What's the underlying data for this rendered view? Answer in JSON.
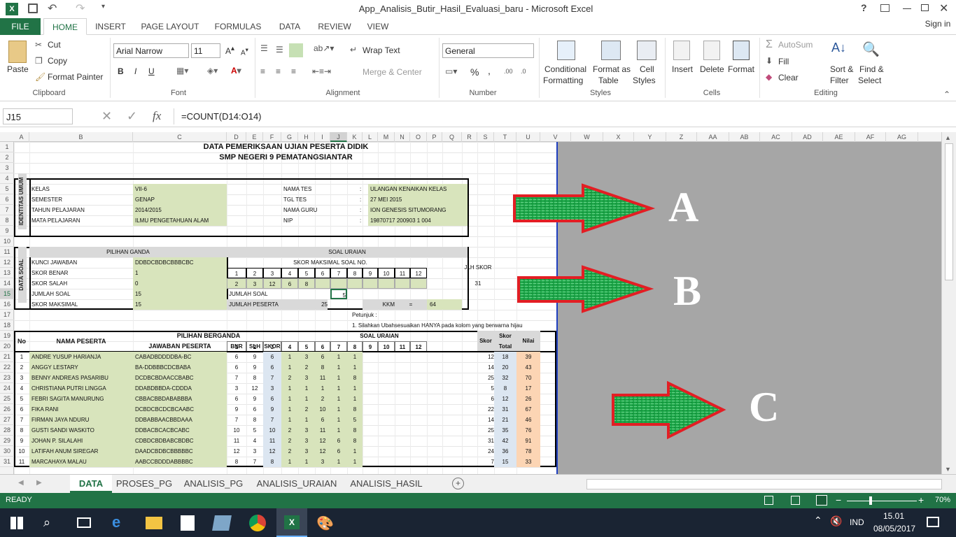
{
  "app": {
    "title": "App_Analisis_Butir_Hasil_Evaluasi_baru - Microsoft Excel",
    "help": "?",
    "signin": "Sign in"
  },
  "ribbon_tabs": [
    "FILE",
    "HOME",
    "INSERT",
    "PAGE LAYOUT",
    "FORMULAS",
    "DATA",
    "REVIEW",
    "VIEW"
  ],
  "clipboard": {
    "paste": "Paste",
    "cut": "Cut",
    "copy": "Copy",
    "format_painter": "Format Painter",
    "label": "Clipboard"
  },
  "font": {
    "name": "Arial Narrow",
    "size": "11",
    "bold": "B",
    "italic": "I",
    "underline": "U",
    "label": "Font"
  },
  "alignment": {
    "wrap": "Wrap Text",
    "merge": "Merge & Center",
    "label": "Alignment"
  },
  "number": {
    "format": "General",
    "percent": "%",
    "comma": ",",
    "label": "Number"
  },
  "styles": {
    "cond": "Conditional",
    "cond2": "Formatting",
    "fmt_table": "Format as",
    "fmt_table2": "Table",
    "cell_styles": "Cell",
    "cell_styles2": "Styles",
    "label": "Styles"
  },
  "cells": {
    "insert": "Insert",
    "delete": "Delete",
    "format": "Format",
    "label": "Cells"
  },
  "editing": {
    "autosum": "AutoSum",
    "fill": "Fill",
    "clear": "Clear",
    "sort": "Sort &",
    "sort2": "Filter",
    "find": "Find &",
    "find2": "Select",
    "label": "Editing"
  },
  "formula_bar": {
    "name_box": "J15",
    "fx": "fx",
    "formula": "=COUNT(D14:O14)"
  },
  "columns": [
    "A",
    "B",
    "C",
    "D",
    "E",
    "F",
    "G",
    "H",
    "I",
    "J",
    "K",
    "L",
    "M",
    "N",
    "O",
    "P",
    "Q",
    "R",
    "S",
    "T",
    "U",
    "V",
    "W",
    "X",
    "Y",
    "Z",
    "AA",
    "AB",
    "AC",
    "AD",
    "AE",
    "AF",
    "AG"
  ],
  "rows": [
    "1",
    "2",
    "3",
    "4",
    "5",
    "6",
    "7",
    "8",
    "9",
    "10",
    "11",
    "12",
    "13",
    "14",
    "15",
    "16",
    "17",
    "18",
    "19",
    "20",
    "21",
    "22",
    "23",
    "24",
    "25",
    "26",
    "27",
    "28",
    "29",
    "30",
    "31"
  ],
  "sheet": {
    "title1": "DATA PEMERIKSAAN UJIAN PESERTA DIDIK",
    "title2": "SMP NEGERI 9 PEMATANGSIANTAR",
    "identitas": "IDENTITAS UMUM",
    "kelas_l": "KELAS",
    "kelas_v": "VII-6",
    "semester_l": "SEMESTER",
    "semester_v": "GENAP",
    "tahun_l": "TAHUN PELAJARAN",
    "tahun_v": "2014/2015",
    "mapel_l": "MATA PELAJARAN",
    "mapel_v": "ILMU PENGETAHUAN ALAM",
    "namates_l": "NAMA TES",
    "namates_v": "ULANGAN KENAIKAN KELAS",
    "tgl_l": "TGL TES",
    "tgl_v": "27 MEI 2015",
    "guru_l": "NAMA GURU",
    "guru_v": "ION GENESIS SITUMORANG",
    "nip_l": "NIP",
    "nip_v": "19870717 200903 1 004",
    "colon": ":",
    "datasoal": "DATA SOAL",
    "pg": "PILIHAN GANDA",
    "uraian": "SOAL URAIAN",
    "kunci_l": "KUNCI JAWABAN",
    "kunci_v": "DDBDCBDBCBBBCBC",
    "benar_l": "SKOR BENAR",
    "benar_v": "1",
    "salah_l": "SKOR SALAH",
    "salah_v": "0",
    "jsoal_l": "JUMLAH SOAL",
    "jsoal_v": "15",
    "maks_l": "SKOR MAKSIMAL",
    "maks_v": "15",
    "skormaks": "SKOR MAKSIMAL SOAL NO.",
    "jlh": "JLH SKOR",
    "soalno": [
      "1",
      "2",
      "3",
      "4",
      "5",
      "6",
      "7",
      "8",
      "9",
      "10",
      "11",
      "12"
    ],
    "skorsoal": [
      "2",
      "3",
      "12",
      "6",
      "8",
      "",
      "",
      "",
      "",
      "",
      "",
      ""
    ],
    "jlh_v": "31",
    "ur_jsoal_l": "JUMLAH SOAL",
    "ur_jsoal_v": "5",
    "ur_jp_l": "JUMLAH PESERTA",
    "ur_jp_v": "25",
    "kkm_l": "KKM",
    "eq": "=",
    "kkm_v": "64",
    "petunjuk": "Petunjuk :",
    "petunjuk1": "1. Silahkan Ubahsesuaikan HANYA pada kolom yang berwarna hijau",
    "h_no": "No",
    "h_nama": "NAMA PESERTA",
    "h_pb": "PILIHAN BERGANDA",
    "h_jp": "JAWABAN PESERTA",
    "h_bnr": "BNR",
    "h_slh": "SLH",
    "h_skor": "SKOR",
    "h_su": "SOAL URAIAN",
    "h_skor2": "Skor",
    "h_skort": "Skor",
    "h_total": "Total",
    "h_nilai": "Nilai",
    "students": [
      {
        "no": "1",
        "nama": "ANDRE YUSUP HARIANJA",
        "jwb": "CABADBDDDDBA-BC",
        "bnr": "6",
        "slh": "9",
        "skor": "6",
        "u": [
          "1",
          "3",
          "6",
          "1",
          "1"
        ],
        "sk": "12",
        "tot": "18",
        "nilai": "39"
      },
      {
        "no": "2",
        "nama": "ANGGY LESTARY",
        "jwb": "BA-DDBBBCDCBABA",
        "bnr": "6",
        "slh": "9",
        "skor": "6",
        "u": [
          "1",
          "2",
          "8",
          "1",
          "1"
        ],
        "sk": "14",
        "tot": "20",
        "nilai": "43"
      },
      {
        "no": "3",
        "nama": "BENNY ANDREAS PASARIBU",
        "jwb": "DCDBCBDAACCBABC",
        "bnr": "7",
        "slh": "8",
        "skor": "7",
        "u": [
          "2",
          "3",
          "11",
          "1",
          "8"
        ],
        "sk": "25",
        "tot": "32",
        "nilai": "70"
      },
      {
        "no": "4",
        "nama": "CHRISTIANA PUTRI LINGGA",
        "jwb": "DDABDBBDA-CDDDA",
        "bnr": "3",
        "slh": "12",
        "skor": "3",
        "u": [
          "1",
          "1",
          "1",
          "1",
          "1"
        ],
        "sk": "5",
        "tot": "8",
        "nilai": "17"
      },
      {
        "no": "5",
        "nama": "FEBRI SAGITA MANURUNG",
        "jwb": "CBBACBBDABABBBA",
        "bnr": "6",
        "slh": "9",
        "skor": "6",
        "u": [
          "1",
          "1",
          "2",
          "1",
          "1"
        ],
        "sk": "6",
        "tot": "12",
        "nilai": "26"
      },
      {
        "no": "6",
        "nama": "FIKA RANI",
        "jwb": "DCBDCBCDCBCAABC",
        "bnr": "9",
        "slh": "6",
        "skor": "9",
        "u": [
          "1",
          "2",
          "10",
          "1",
          "8"
        ],
        "sk": "22",
        "tot": "31",
        "nilai": "67"
      },
      {
        "no": "7",
        "nama": "FIRMAN JAYA NDURU",
        "jwb": "DDBABBAACBBDAAA",
        "bnr": "7",
        "slh": "8",
        "skor": "7",
        "u": [
          "1",
          "1",
          "6",
          "1",
          "5"
        ],
        "sk": "14",
        "tot": "21",
        "nilai": "46"
      },
      {
        "no": "8",
        "nama": "GUSTI SANDI WASKITO",
        "jwb": "DDBACBCACBCABC",
        "bnr": "10",
        "slh": "5",
        "skor": "10",
        "u": [
          "2",
          "3",
          "11",
          "1",
          "8"
        ],
        "sk": "25",
        "tot": "35",
        "nilai": "76"
      },
      {
        "no": "9",
        "nama": "JOHAN P. SILALAHI",
        "jwb": "CDBDCBDBABCBDBC",
        "bnr": "11",
        "slh": "4",
        "skor": "11",
        "u": [
          "2",
          "3",
          "12",
          "6",
          "8"
        ],
        "sk": "31",
        "tot": "42",
        "nilai": "91"
      },
      {
        "no": "10",
        "nama": "LATIFAH ANUM SIREGAR",
        "jwb": "DAADCBDBCBBBBBC",
        "bnr": "12",
        "slh": "3",
        "skor": "12",
        "u": [
          "2",
          "3",
          "12",
          "6",
          "1"
        ],
        "sk": "24",
        "tot": "36",
        "nilai": "78"
      },
      {
        "no": "11",
        "nama": "MARCAHAYA MALAU",
        "jwb": "AABCCBDDDABBBBC",
        "bnr": "8",
        "slh": "7",
        "skor": "8",
        "u": [
          "1",
          "1",
          "3",
          "1",
          "1"
        ],
        "sk": "7",
        "tot": "15",
        "nilai": "33"
      }
    ]
  },
  "arrows": [
    "A",
    "B",
    "C"
  ],
  "sheet_tabs": [
    "DATA",
    "PROSES_PG",
    "ANALISIS_PG",
    "ANALISIS_URAIAN",
    "ANALISIS_HASIL"
  ],
  "status": {
    "ready": "READY",
    "zoom": "70%"
  },
  "taskbar": {
    "lang": "IND",
    "time": "15.01",
    "date": "08/05/2017"
  },
  "colors": {
    "excel_green": "#217346",
    "cell_green": "#d8e4bc",
    "nilai_orange": "#fcd5b4",
    "arrow_green": "#1fa84a",
    "arrow_red": "#e31e24"
  }
}
